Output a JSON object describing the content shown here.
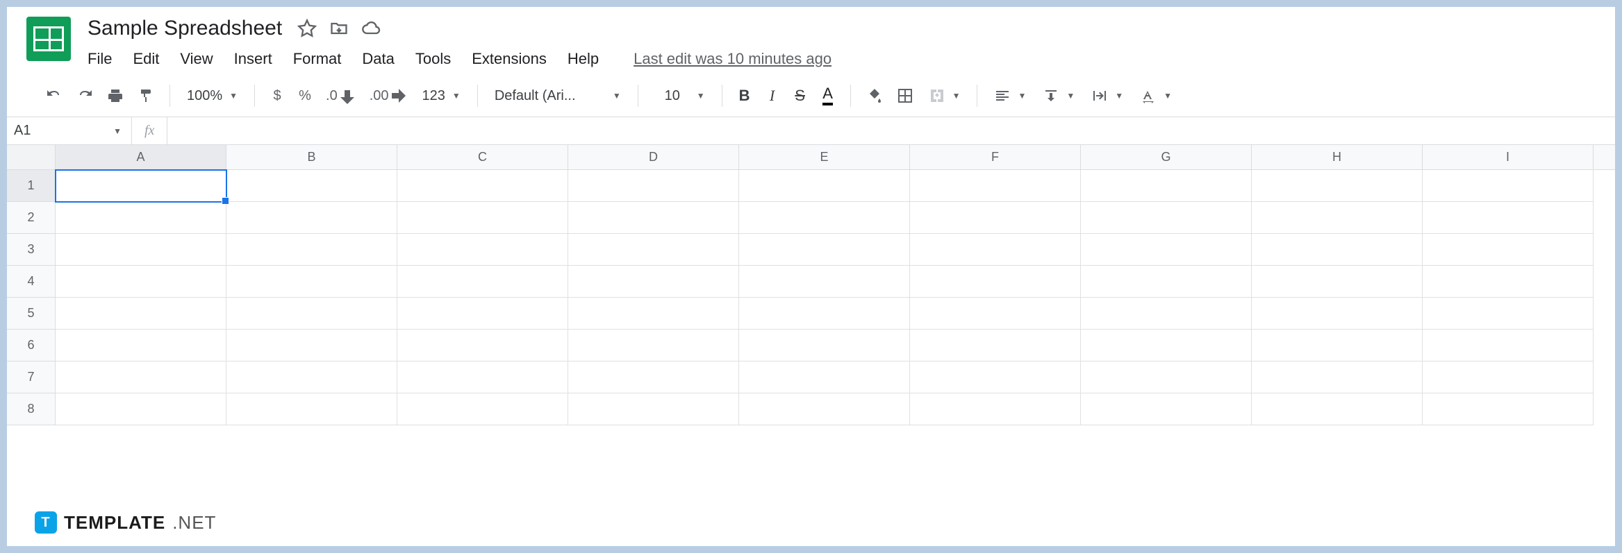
{
  "doc": {
    "title": "Sample Spreadsheet",
    "last_edit": "Last edit was 10 minutes ago"
  },
  "menus": [
    "File",
    "Edit",
    "View",
    "Insert",
    "Format",
    "Data",
    "Tools",
    "Extensions",
    "Help"
  ],
  "toolbar": {
    "zoom": "100%",
    "currency": "$",
    "percent": "%",
    "dec_dec": ".0",
    "inc_dec": ".00",
    "more_formats": "123",
    "font_name": "Default (Ari...",
    "font_size": "10"
  },
  "namebox": {
    "value": "A1"
  },
  "fx": {
    "label": "fx",
    "value": ""
  },
  "grid": {
    "columns": [
      "A",
      "B",
      "C",
      "D",
      "E",
      "F",
      "G",
      "H",
      "I"
    ],
    "rows": [
      "1",
      "2",
      "3",
      "4",
      "5",
      "6",
      "7",
      "8"
    ],
    "active_cell": "A1"
  },
  "watermark": {
    "badge": "T",
    "strong": "TEMPLATE",
    "light": ".NET"
  }
}
